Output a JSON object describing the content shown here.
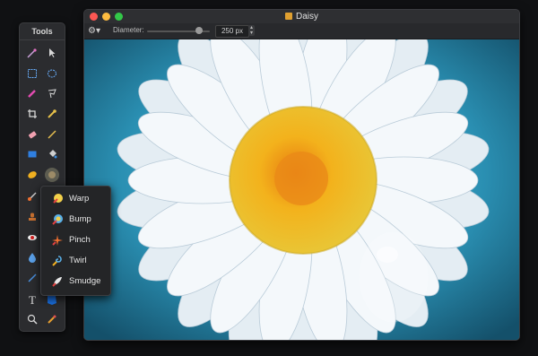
{
  "tools_panel": {
    "title": "Tools",
    "tools": [
      {
        "icon": "magic-wand-icon"
      },
      {
        "icon": "arrow-cursor-icon"
      },
      {
        "icon": "rect-select-icon"
      },
      {
        "icon": "ellipse-select-icon"
      },
      {
        "icon": "paint-select-icon"
      },
      {
        "icon": "lasso-icon"
      },
      {
        "icon": "crop-icon"
      },
      {
        "icon": "eyedropper-icon"
      },
      {
        "icon": "eraser-icon"
      },
      {
        "icon": "pencil-icon"
      },
      {
        "icon": "rectangle-shape-icon"
      },
      {
        "icon": "paint-bucket-icon"
      },
      {
        "icon": "smudge-tool-icon"
      },
      {
        "icon": "distort-tool-icon"
      },
      {
        "icon": "brush-icon"
      },
      {
        "icon": "clone-stamp-icon"
      },
      {
        "icon": "red-eye-icon"
      },
      {
        "icon": "blur-drop-icon"
      },
      {
        "icon": "line-icon"
      },
      {
        "icon": "text-icon"
      },
      {
        "icon": "color-swatch-icon"
      },
      {
        "icon": "zoom-icon"
      },
      {
        "icon": "color-picker-icon"
      }
    ]
  },
  "window": {
    "title": "Daisy",
    "toolbar": {
      "diameter_label": "Diameter:",
      "diameter_value": "250 px"
    }
  },
  "popup_menu": {
    "items": [
      {
        "label": "Warp",
        "icon": "warp-icon"
      },
      {
        "label": "Bump",
        "icon": "bump-icon"
      },
      {
        "label": "Pinch",
        "icon": "pinch-icon"
      },
      {
        "label": "Twirl",
        "icon": "twirl-icon"
      },
      {
        "label": "Smudge",
        "icon": "smudge-icon"
      }
    ]
  },
  "colors": {
    "close": "#fc5753",
    "minimize": "#fdbc40",
    "zoom": "#33c748",
    "accent_blue": "#2b8fb3"
  }
}
